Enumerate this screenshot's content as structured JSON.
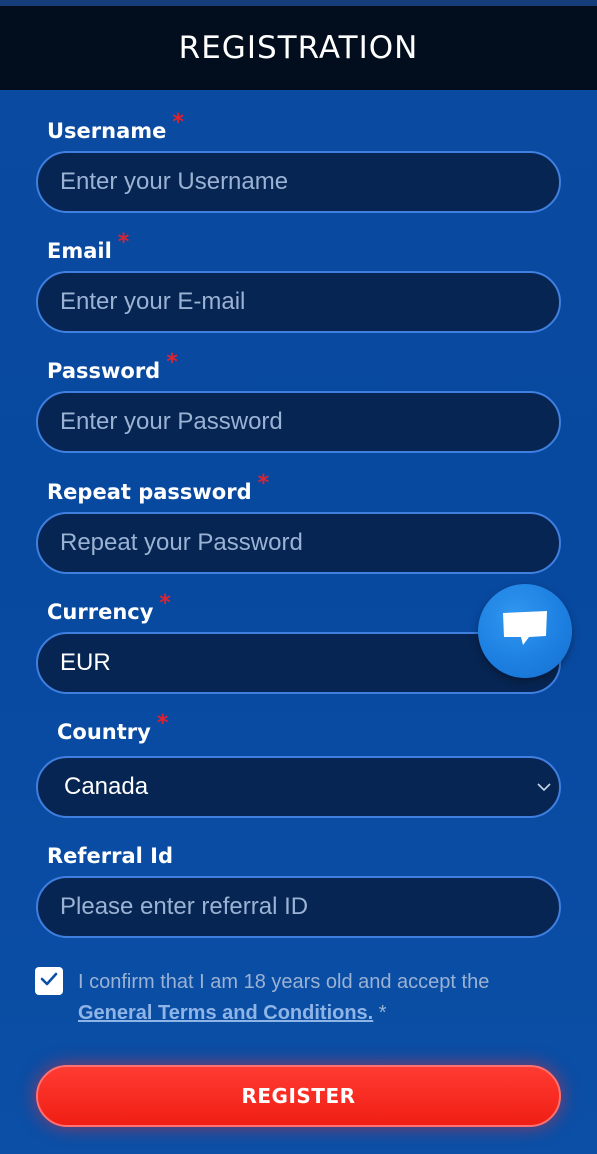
{
  "header": {
    "title": "REGISTRATION"
  },
  "form": {
    "username": {
      "label": "Username",
      "required_mark": "*",
      "placeholder": "Enter your Username"
    },
    "email": {
      "label": "Email",
      "required_mark": "*",
      "placeholder": "Enter your E-mail"
    },
    "password": {
      "label": "Password",
      "required_mark": "*",
      "placeholder": "Enter your Password"
    },
    "repeat_password": {
      "label": "Repeat password",
      "required_mark": "*",
      "placeholder": "Repeat your Password"
    },
    "currency": {
      "label": "Currency",
      "required_mark": "*",
      "value": "EUR"
    },
    "country": {
      "label": "Country",
      "required_mark": "*",
      "value": "Canada"
    },
    "referral": {
      "label": "Referral Id",
      "placeholder": "Please enter referral ID"
    }
  },
  "consent": {
    "checked": true,
    "text": "I confirm that I am 18 years old and accept the",
    "link_text": "General Terms and Conditions.",
    "required_mark": "*"
  },
  "register_button": {
    "label": "REGISTER"
  },
  "icons": {
    "chat": "chat-icon",
    "checkmark": "checkmark-icon",
    "chevron": "chevron-down-icon"
  },
  "colors": {
    "background": "#0849a0",
    "header_bg": "#020d1d",
    "field_bg": "#072552",
    "field_border": "#3f7fe0",
    "required": "#e0222f",
    "button": "#f01e14",
    "chat_bubble": "#1c7ee0"
  }
}
